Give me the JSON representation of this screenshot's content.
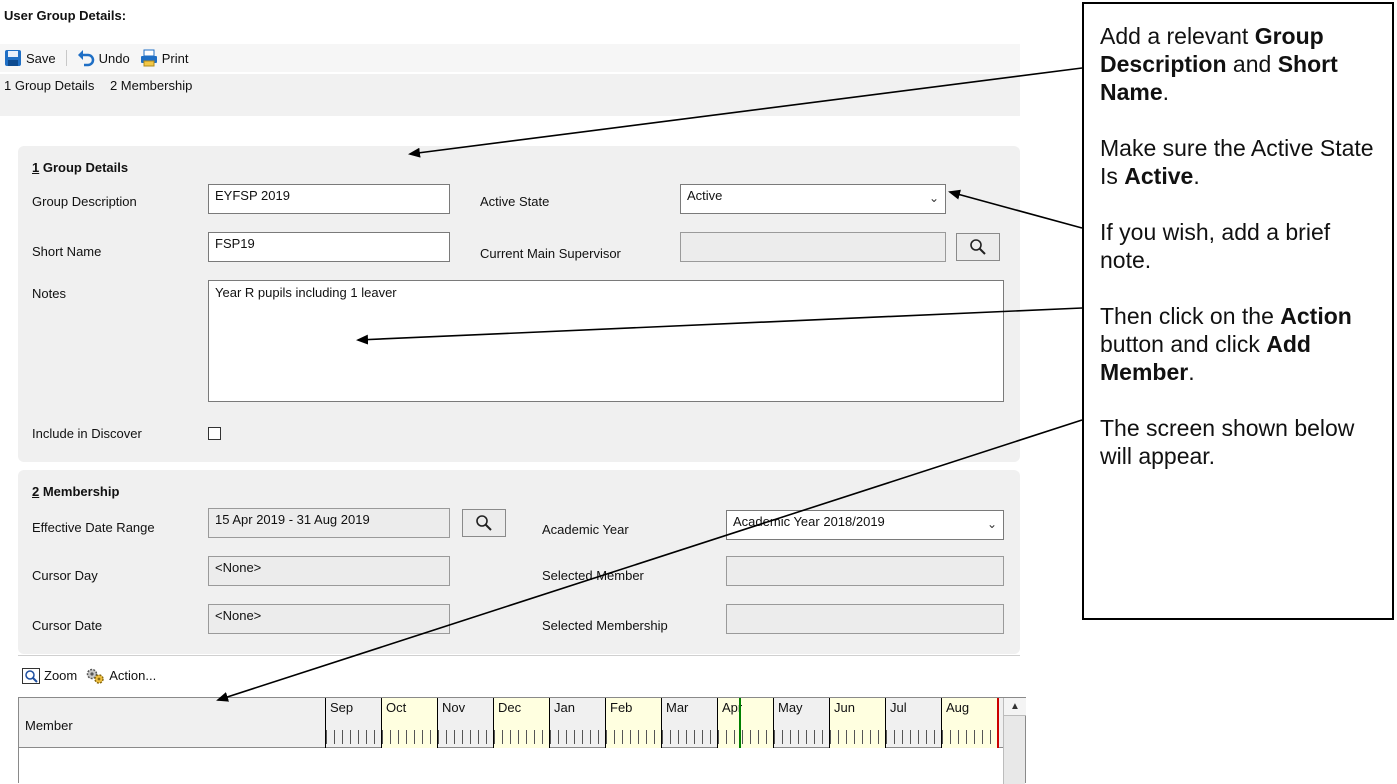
{
  "window": {
    "title": "User Group Details:"
  },
  "toolbar": {
    "save": "Save",
    "undo": "Undo",
    "print": "Print"
  },
  "tabs": [
    {
      "label": "1 Group Details"
    },
    {
      "label": "2 Membership"
    }
  ],
  "group_details": {
    "heading_num": "1",
    "heading_text": " Group Details",
    "description_label": "Group Description",
    "description_value": "EYFSP 2019",
    "short_name_label": "Short Name",
    "short_name_value": "FSP19",
    "notes_label": "Notes",
    "notes_value": "Year R pupils including 1 leaver",
    "active_state_label": "Active State",
    "active_state_value": "Active",
    "supervisor_label": "Current Main Supervisor",
    "supervisor_value": "",
    "discover_label": "Include in Discover"
  },
  "membership": {
    "heading_num": "2",
    "heading_text": " Membership",
    "date_range_label": "Effective Date Range",
    "date_range_value": "15 Apr 2019 - 31 Aug 2019",
    "academic_year_label": "Academic Year",
    "academic_year_value": "Academic Year 2018/2019",
    "cursor_day_label": "Cursor Day",
    "cursor_day_value": "<None>",
    "selected_member_label": "Selected Member",
    "selected_member_value": "",
    "cursor_date_label": "Cursor Date",
    "cursor_date_value": "<None>",
    "selected_membership_label": "Selected Membership",
    "selected_membership_value": ""
  },
  "grid_toolbar": {
    "zoom": "Zoom",
    "action": "Action..."
  },
  "grid": {
    "member_header": "Member",
    "months": [
      "Sep",
      "Oct",
      "Nov",
      "Dec",
      "Jan",
      "Feb",
      "Mar",
      "Apr",
      "May",
      "Jun",
      "Jul",
      "Aug"
    ]
  },
  "callout": {
    "p1_a": "Add a relevant ",
    "p1_b": "Group Description",
    "p1_c": " and ",
    "p1_d": "Short Name",
    "p1_e": ".",
    "p2_a": "Make sure the Active State Is ",
    "p2_b": "Active",
    "p2_c": ".",
    "p3": "If you wish, add a brief note.",
    "p4_a": "Then click on the ",
    "p4_b": "Action",
    "p4_c": " button and click ",
    "p4_d": "Add Member",
    "p4_e": ".",
    "p5": "The screen shown below will appear."
  },
  "colors": {
    "shaded_month": "#ffffe0",
    "section_bg": "#f0f0f0",
    "today_line": "#008000",
    "end_line": "#cc0000"
  },
  "icons": [
    "save-icon",
    "undo-icon",
    "print-icon",
    "search-icon",
    "zoom-icon",
    "action-icon",
    "chevron-down-icon",
    "scroll-up-icon"
  ]
}
